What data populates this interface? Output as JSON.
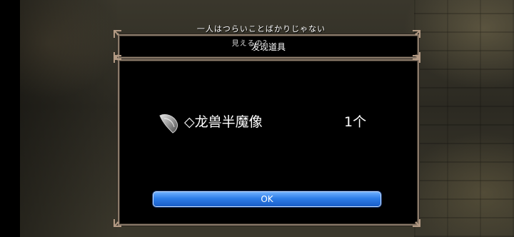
{
  "scene": {
    "title_line1": "一人はつらいことばかりじゃない",
    "title_line2": "見えるの？"
  },
  "dialog": {
    "header": "发现道具",
    "item": {
      "icon": "gray-fang-item-icon",
      "name": "◇龙兽半魔像",
      "count": "1个"
    },
    "ok_label": "OK"
  },
  "colors": {
    "frame": "#8a7a6a",
    "button_top": "#6fb0ff",
    "button_bottom": "#1a5ec8"
  }
}
